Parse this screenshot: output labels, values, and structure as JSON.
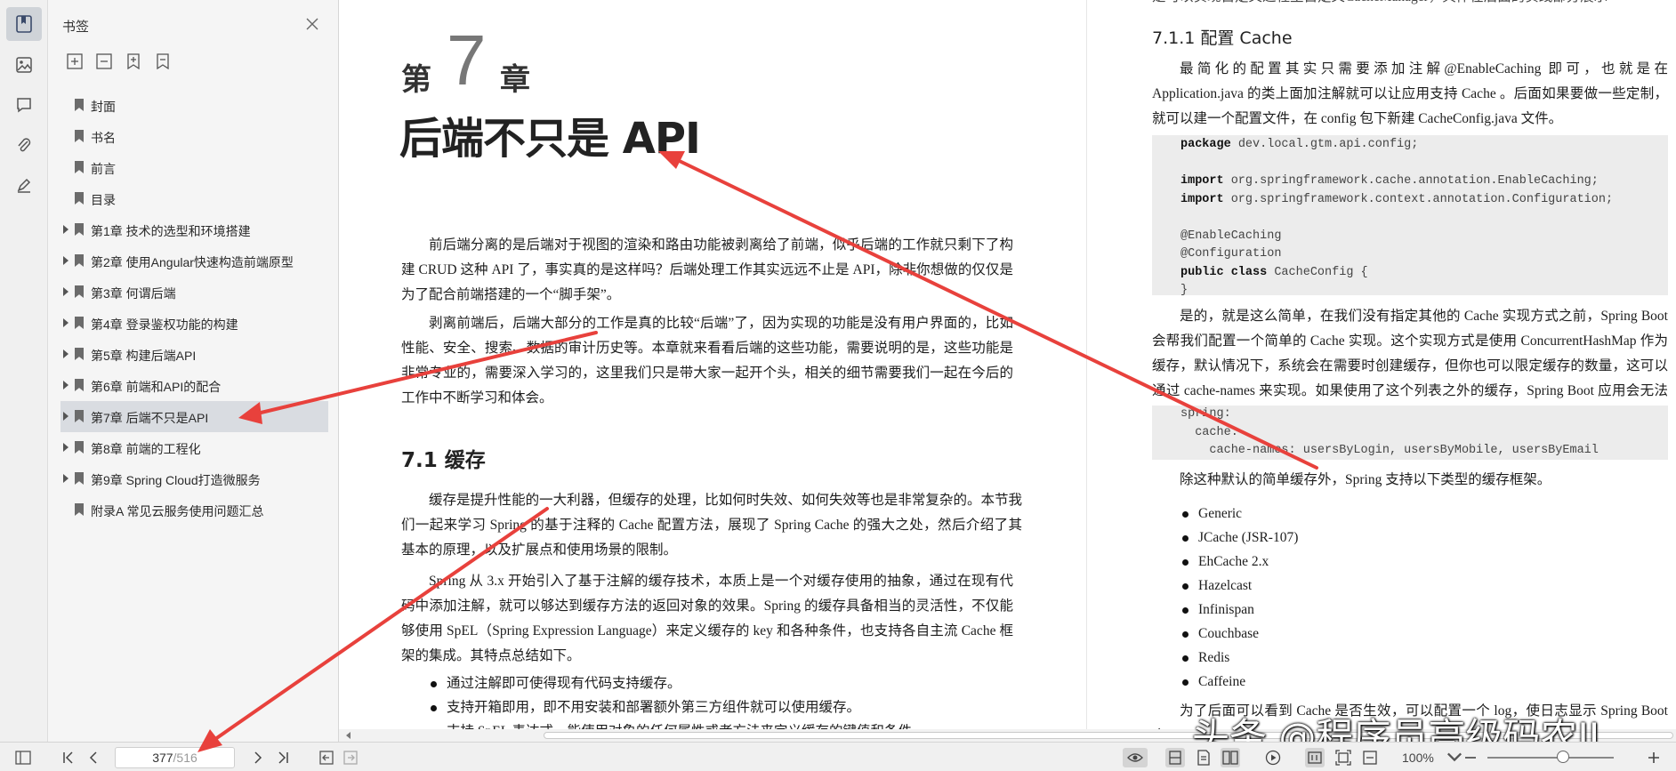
{
  "sidebar_panel": {
    "title": "书签",
    "bookmarks": [
      {
        "label": "封面",
        "expandable": false
      },
      {
        "label": "书名",
        "expandable": false
      },
      {
        "label": "前言",
        "expandable": false
      },
      {
        "label": "目录",
        "expandable": false
      },
      {
        "label": "第1章 技术的选型和环境搭建",
        "expandable": true
      },
      {
        "label": "第2章 使用Angular快速构造前端原型",
        "expandable": true
      },
      {
        "label": "第3章 何谓后端",
        "expandable": true
      },
      {
        "label": "第4章 登录鉴权功能的构建",
        "expandable": true
      },
      {
        "label": "第5章 构建后端API",
        "expandable": true
      },
      {
        "label": "第6章 前端和API的配合",
        "expandable": true
      },
      {
        "label": "第7章 后端不只是API",
        "expandable": true,
        "selected": true
      },
      {
        "label": "第8章 前端的工程化",
        "expandable": true
      },
      {
        "label": "第9章 Spring Cloud打造微服务",
        "expandable": true
      },
      {
        "label": "附录A 常见云服务使用问题汇总",
        "expandable": false
      }
    ]
  },
  "left_page": {
    "chapter_word1": "第",
    "chapter_number": "7",
    "chapter_word2": "章",
    "chapter_title": "后端不只是 API",
    "intro_p1": "前后端分离的是后端对于视图的渲染和路由功能被剥离给了前端，似乎后端的工作就只剩下了构建 CRUD 这种 API 了，事实真的是这样吗？后端处理工作其实远远不止是 API，除非你想做的仅仅是为了配合前端搭建的一个“脚手架”。",
    "intro_p2": "剥离前端后，后端大部分的工作是真的比较“后端”了，因为实现的功能是没有用户界面的，比如性能、安全、搜索、数据的审计历史等。本章就来看看后端的这些功能，需要说明的是，这些功能是非常专业的，需要深入学习的，这里我们只是带大家一起开个头，相关的细节需要我们一起在今后的工作中不断学习和体会。",
    "section_heading": "7.1 缓存",
    "section_p1": "缓存是提升性能的一大利器，但缓存的处理，比如何时失效、如何失效等也是非常复杂的。本节我们一起来学习 Spring 的基于注释的 Cache 配置方法，展现了 Spring Cache 的强大之处，然后介绍了其基本的原理，以及扩展点和使用场景的限制。",
    "section_p2": "Spring 从 3.x 开始引入了基于注解的缓存技术，本质上是一个对缓存使用的抽象，通过在现有代码中添加注解，就可以够达到缓存方法的返回对象的效果。Spring 的缓存具备相当的灵活性，不仅能够使用 SpEL（Spring Expression Language）来定义缓存的 key 和各种条件，也支持各自主流 Cache 框架的集成。其特点总结如下。",
    "bullets": [
      "通过注解即可使得现有代码支持缓存。",
      "支持开箱即用，即不用安装和部署额外第三方组件就可以使用缓存。",
      "支持 SpEL 表达式，能使用对象的任何属性或者方法来定义缓存的键值和条件。"
    ]
  },
  "right_page": {
    "top_cut_text": "是可以实现自定义过程里自定义CacheManager，具体在后面的实践部分展示",
    "section_heading": "7.1.1  配置 Cache",
    "p1": "最简化的配置其实只需要添加注解@EnableCaching 即可，也就是在 Application.java 的类上面加注解就可以让应用支持 Cache 。后面如果要做一些定制，就可以建一个配置文件，在 config 包下新建 CacheConfig.java 文件。",
    "code1": [
      {
        "kw": "package",
        "rest": " dev.local.gtm.api.config;"
      },
      {
        "kw": "",
        "rest": ""
      },
      {
        "kw": "import",
        "rest": " org.springframework.cache.annotation.EnableCaching;"
      },
      {
        "kw": "import",
        "rest": " org.springframework.context.annotation.Configuration;"
      },
      {
        "kw": "",
        "rest": ""
      },
      {
        "kw": "",
        "rest": "@EnableCaching"
      },
      {
        "kw": "",
        "rest": "@Configuration"
      },
      {
        "kw": "public class",
        "rest": " CacheConfig {"
      },
      {
        "kw": "",
        "rest": "}"
      }
    ],
    "p2": "是的，就是这么简单，在我们没有指定其他的 Cache 实现方式之前，Spring Boot 会帮我们配置一个简单的 Cache 实现。这个实现方式是使用 ConcurrentHashMap 作为缓存，默认情况下，系统会在需要时创建缓存，但你也可以限定缓存的数量，这可以通过 cache-names 来实现。如果使用了这个列表之外的缓存，Spring Boot 应用会无法启动。",
    "code2": [
      "spring:",
      "  cache:",
      "    cache-names: usersByLogin, usersByMobile, usersByEmail"
    ],
    "p3": "除这种默认的简单缓存外，Spring 支持以下类型的缓存框架。",
    "bullets": [
      "Generic",
      "JCache (JSR-107)",
      "EhCache 2.x",
      "Hazelcast",
      "Infinispan",
      "Couchbase",
      "Redis",
      "Caffeine"
    ],
    "bottom_cut_text": "为了后面可以看到 Cache 是否生效，可以配置一个 log，使日志显示 Spring Boot 应用"
  },
  "statusbar": {
    "page_current": "377",
    "page_total": "/516",
    "zoom": "100%"
  },
  "watermark": "头条 @程序员高级码农II",
  "colors": {
    "arrow": "#e8413c",
    "panel_bg": "#f5f5f5",
    "selected_bg": "#d9dce1"
  }
}
